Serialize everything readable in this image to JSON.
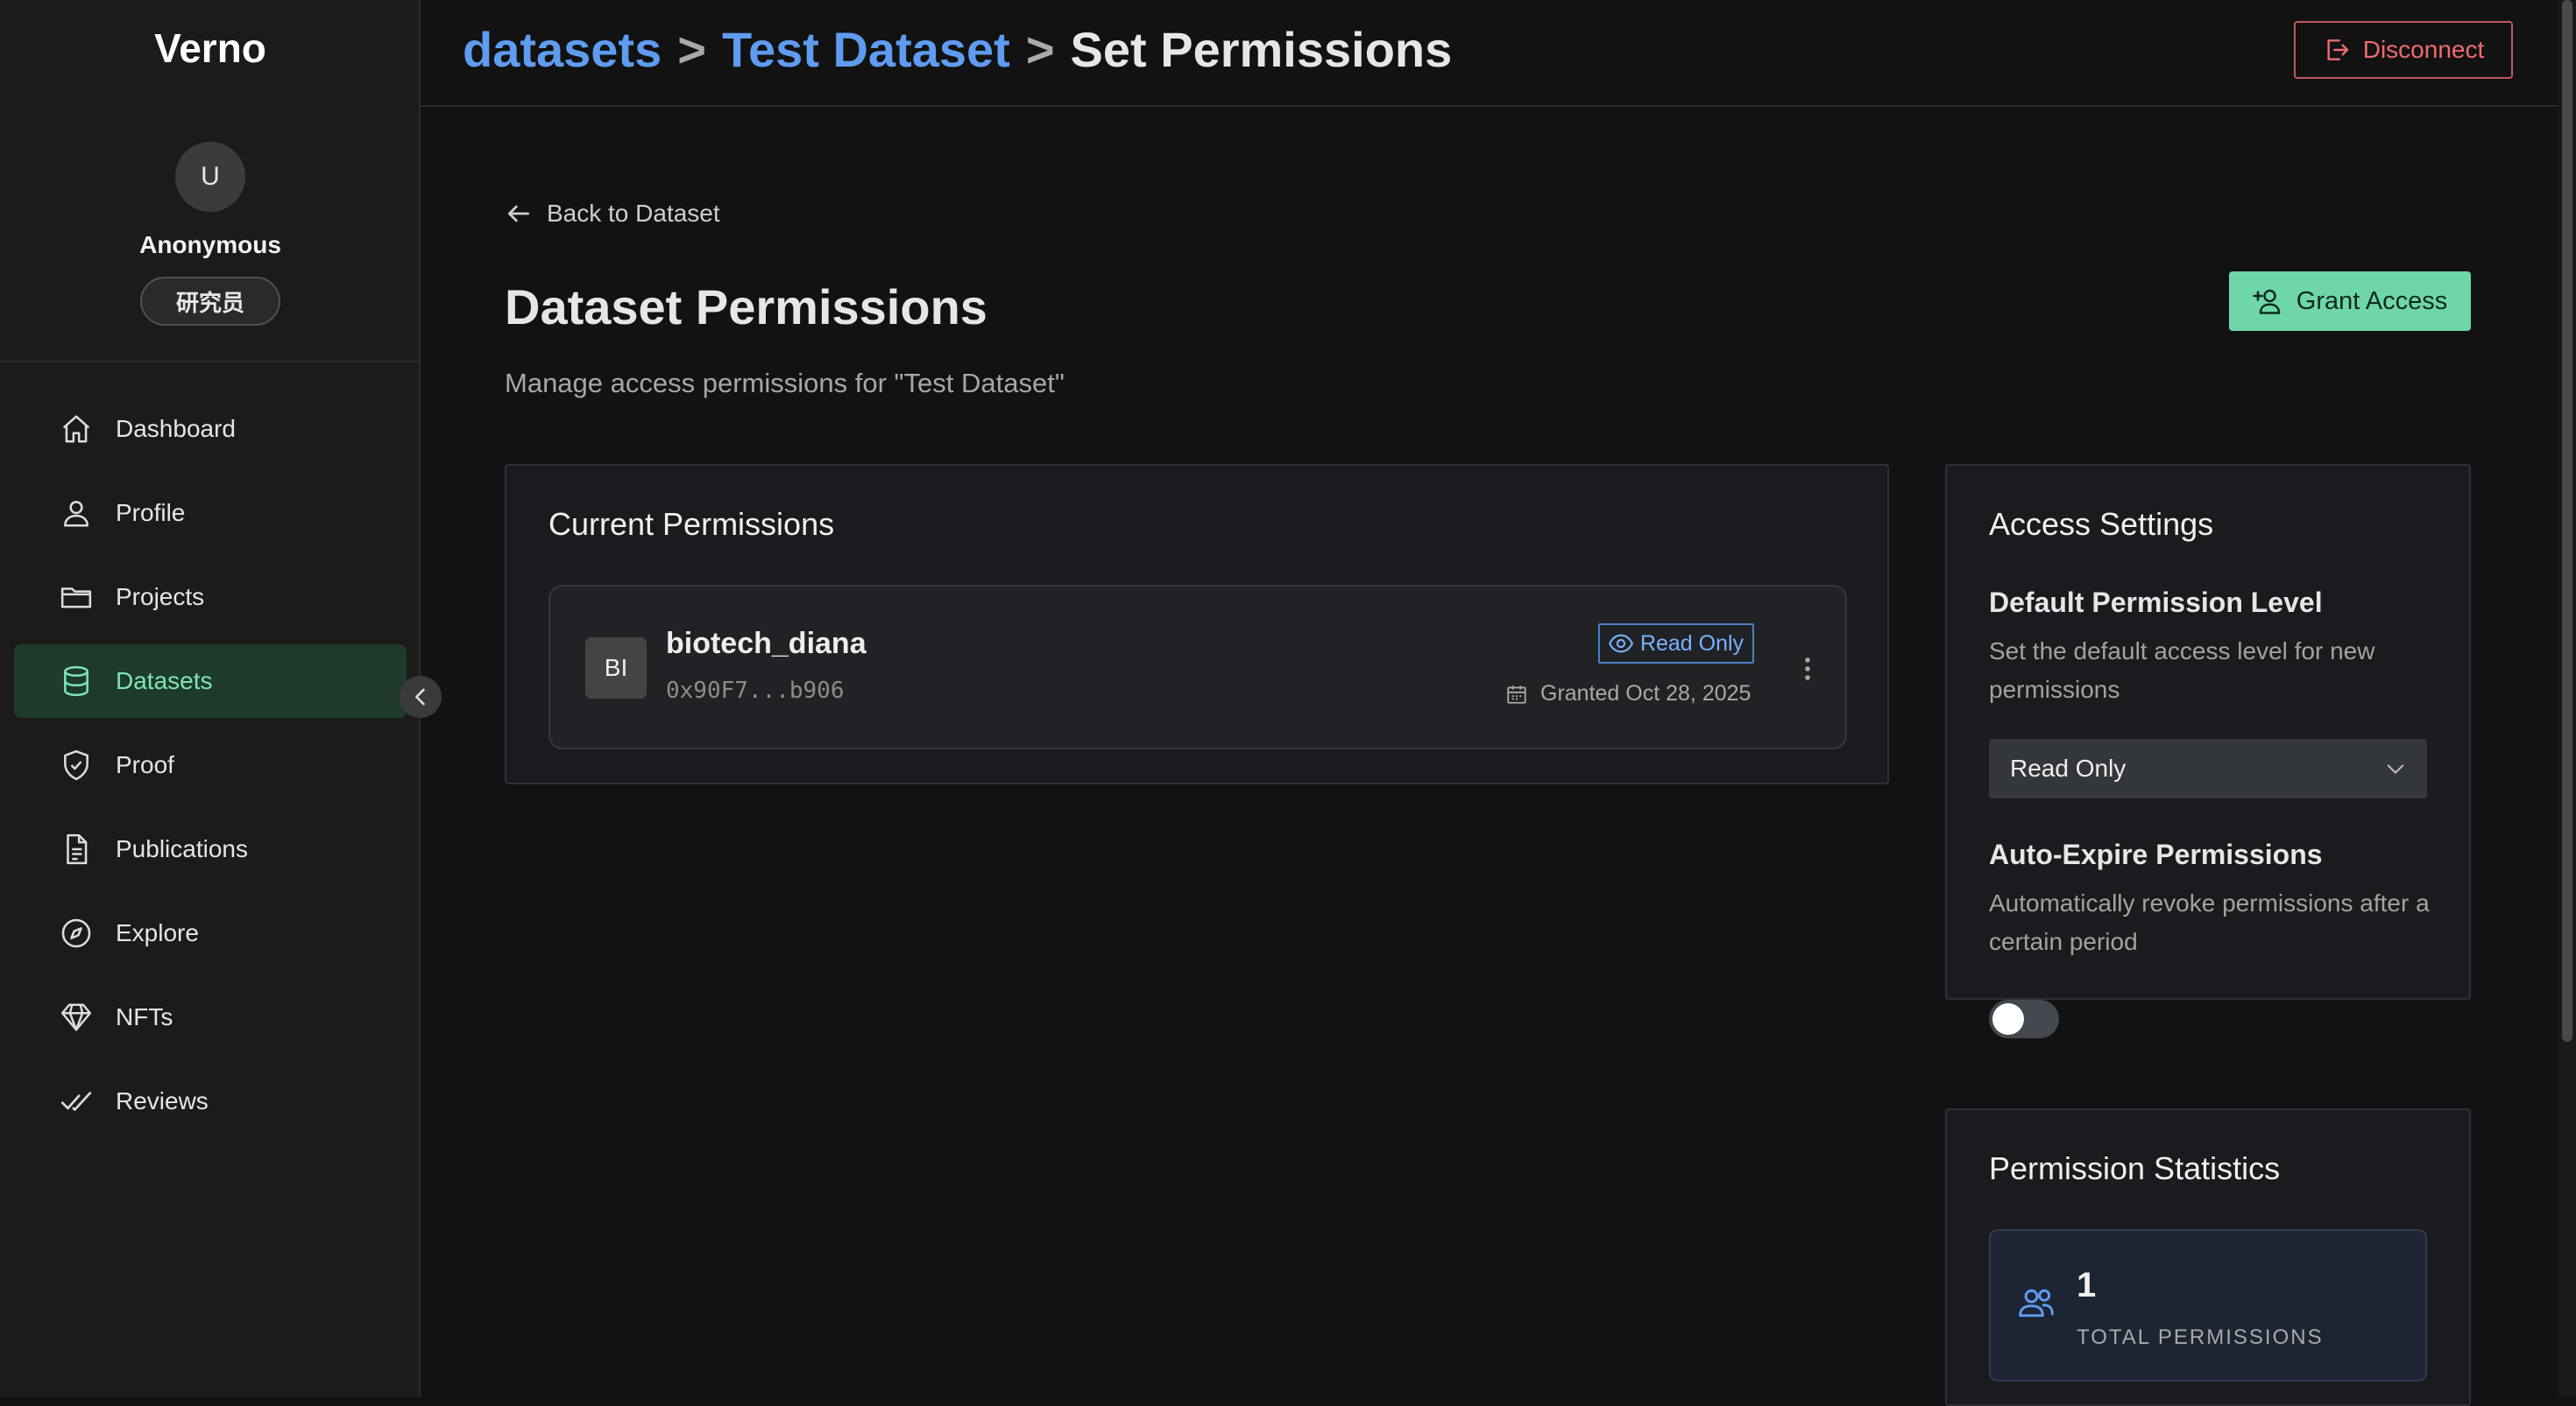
{
  "sidebar": {
    "brand": "Verno",
    "avatar_initial": "U",
    "user_name": "Anonymous",
    "role": "研究员",
    "items": [
      {
        "label": "Dashboard",
        "icon": "home-icon"
      },
      {
        "label": "Profile",
        "icon": "user-icon"
      },
      {
        "label": "Projects",
        "icon": "folder-icon"
      },
      {
        "label": "Datasets",
        "icon": "database-icon",
        "active": true
      },
      {
        "label": "Proof",
        "icon": "shield-check-icon"
      },
      {
        "label": "Publications",
        "icon": "document-icon"
      },
      {
        "label": "Explore",
        "icon": "compass-icon"
      },
      {
        "label": "NFTs",
        "icon": "diamond-icon"
      },
      {
        "label": "Reviews",
        "icon": "double-check-icon"
      }
    ]
  },
  "header": {
    "breadcrumb": [
      "datasets",
      "Test Dataset",
      "Set Permissions"
    ],
    "separator": ">",
    "disconnect_label": "Disconnect"
  },
  "main": {
    "back_label": "Back to Dataset",
    "title": "Dataset Permissions",
    "subtitle": "Manage access permissions for \"Test Dataset\"",
    "grant_label": "Grant Access"
  },
  "permissions": {
    "title": "Current Permissions",
    "rows": [
      {
        "initials": "BI",
        "username": "biotech_diana",
        "address": "0x90F7...b906",
        "level": "Read Only",
        "granted": "Granted Oct 28, 2025"
      }
    ]
  },
  "settings": {
    "title": "Access Settings",
    "default_heading": "Default Permission Level",
    "default_desc": "Set the default access level for new permissions",
    "default_value": "Read Only",
    "expire_heading": "Auto-Expire Permissions",
    "expire_desc": "Automatically revoke permissions after a certain period",
    "expire_enabled": false
  },
  "stats": {
    "title": "Permission Statistics",
    "total_value": "1",
    "total_label": "TOTAL PERMISSIONS"
  },
  "colors": {
    "accent_green": "#6fd6a8",
    "link_blue": "#5f9cf0",
    "danger_red": "#ee6b6e",
    "badge_blue": "#79b1ff"
  }
}
